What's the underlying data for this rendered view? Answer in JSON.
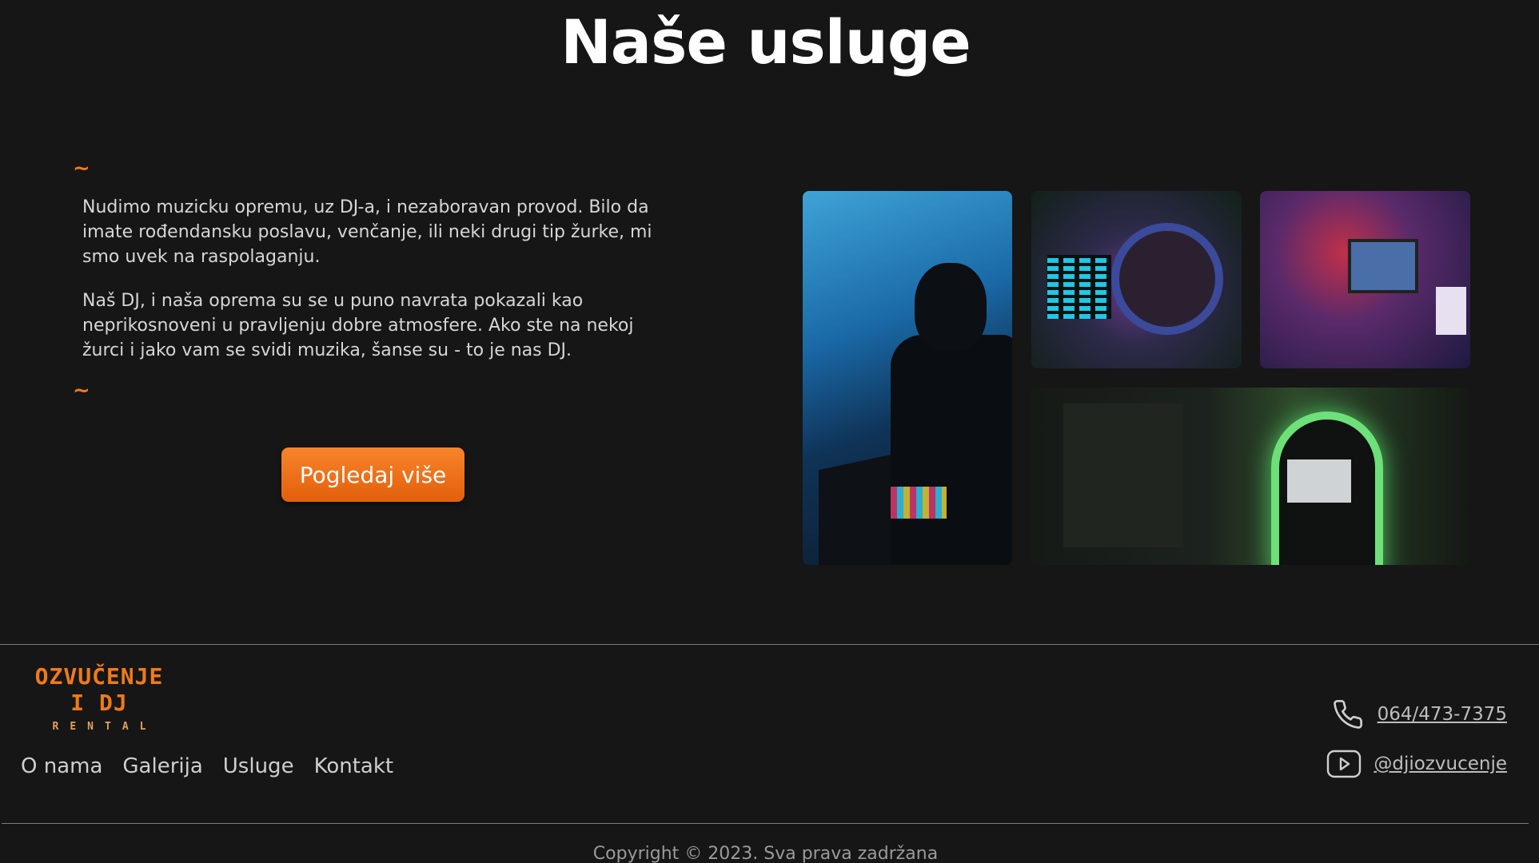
{
  "section": {
    "title": "Naše usluge",
    "tilde_top": "~",
    "tilde_bottom": "~",
    "paragraph_1": "Nudimo muzicku opremu, uz DJ-a, i nezaboravan provod. Bilo da imate rođendansku poslavu, venčanje, ili neki drugi tip žurke, mi smo uvek na raspolaganju.",
    "paragraph_2": "Naš DJ, i naša oprema su se u puno navrata pokazali kao neprikosnoveni u pravljenju dobre atmosfere. Ako ste na nekoj žurci i jako vam se svidi muzika, šanse su - to je nas DJ.",
    "cta_label": "Pogledaj više"
  },
  "footer": {
    "logo_line_1": "OZVUČENJE",
    "logo_line_2": "I DJ",
    "logo_line_3": "RENTAL",
    "nav": [
      "O nama",
      "Galerija",
      "Usluge",
      "Kontakt"
    ],
    "phone": "064/473-7375",
    "youtube": "@djiozvucenje",
    "copyright": "Copyright © 2023. Sva prava zadržana"
  },
  "icons": {
    "phone": "phone-icon",
    "youtube": "youtube-icon"
  },
  "colors": {
    "accent": "#f07a1a",
    "background": "#161616"
  }
}
